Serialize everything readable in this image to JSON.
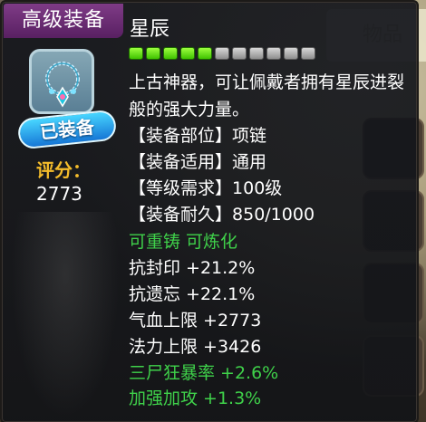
{
  "tag": "高级装备",
  "item": {
    "name": "星辰",
    "grade_filled": 5,
    "grade_total": 11,
    "description": "上古神器，可让佩戴者拥有星辰进裂般的强大力量。"
  },
  "equipped_badge": "已装备",
  "score": {
    "label": "评分：",
    "value": "2773"
  },
  "info_rows": [
    {
      "label": "【装备部位】",
      "value": "项链"
    },
    {
      "label": "【装备适用】",
      "value": "通用"
    },
    {
      "label": "【等级需求】",
      "value": "100级"
    },
    {
      "label": "【装备耐久】",
      "value": "850/1000"
    }
  ],
  "flags": "可重铸 可炼化",
  "stats": [
    {
      "text": "抗封印 +21.2%",
      "color": "white"
    },
    {
      "text": "抗遗忘 +22.1%",
      "color": "white"
    },
    {
      "text": "气血上限 +2773",
      "color": "white"
    },
    {
      "text": "法力上限 +3426",
      "color": "white"
    },
    {
      "text": "三尸狂暴率 +2.6%",
      "color": "green"
    },
    {
      "text": "加强加攻 +1.3%",
      "color": "green"
    }
  ],
  "background": {
    "tab_label": "物品"
  },
  "colors": {
    "tag": "#6e2a77",
    "score": "#f5bd2b",
    "green": "#3fd14a",
    "bar_on": "#6ae81f",
    "bar_off": "#b0b0b0"
  }
}
